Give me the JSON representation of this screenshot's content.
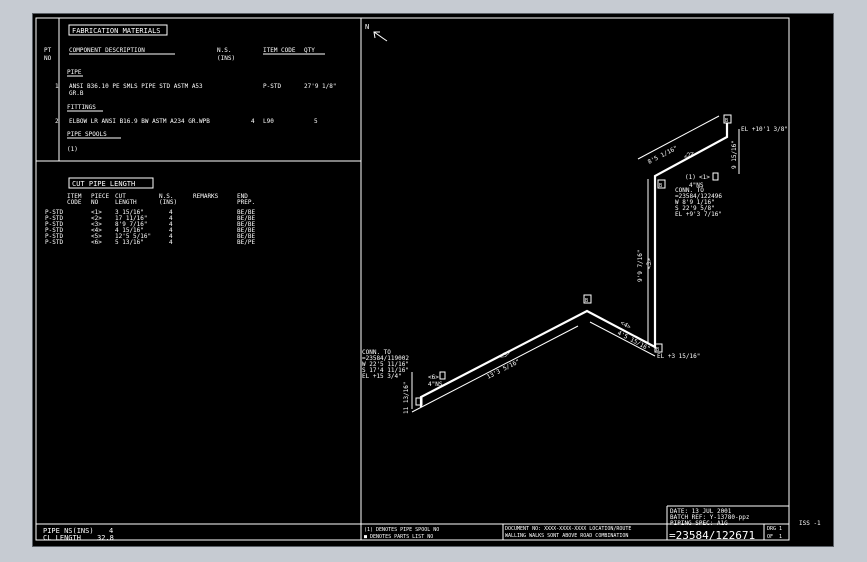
{
  "fabrication_materials": {
    "title": "FABRICATION MATERIALS",
    "col_pt_no": "PT\nNO",
    "col_component": "COMPONENT DESCRIPTION",
    "col_ns": "N.S.\n(INS)",
    "col_item_code": "ITEM CODE",
    "col_qty": "QTY",
    "section_pipe": "PIPE",
    "pipe_item": {
      "pt": "1",
      "desc_line1": "ANSI B36.10 PE SMLS PIPE STD ASTM A53",
      "desc_line2": "GR.B",
      "code": "P-STD",
      "qty": "27'9 1/8\""
    },
    "section_fittings": "FITTINGS",
    "fitting_item": {
      "pt": "2",
      "desc": "ELBOW LR ANSI B16.9 BW ASTM A234 GR.WPB",
      "ns": "4",
      "code": "L90",
      "qty": "5"
    },
    "section_spools": "PIPE SPOOLS",
    "spool_ref": "(1)"
  },
  "cut_pipe_length": {
    "title": "CUT PIPE LENGTH",
    "headers": [
      "ITEM\nCODE",
      "PIECE\nNO",
      "CUT\nLENGTH",
      "N.S.\n(INS)",
      "REMARKS",
      "END\nPREP."
    ],
    "rows": [
      [
        "P-STD",
        "<1>",
        "3 15/16\"",
        "4",
        "",
        "BE/BE"
      ],
      [
        "P-STD",
        "<2>",
        "17 11/16\"",
        "4",
        "",
        "BE/BE"
      ],
      [
        "P-STD",
        "<3>",
        "8'9 7/16\"",
        "4",
        "",
        "BE/BE"
      ],
      [
        "P-STD",
        "<4>",
        "4 15/16\"",
        "4",
        "",
        "BE/BE"
      ],
      [
        "P-STD",
        "<5>",
        "12'5 5/16\"",
        "4",
        "",
        "BE/BE"
      ],
      [
        "P-STD",
        "<6>",
        "5 13/16\"",
        "4",
        "",
        "BE/PE"
      ]
    ]
  },
  "summary": {
    "pipe_ns_label": "PIPE NS(INS)",
    "pipe_ns_value": "4",
    "cl_length_label": "CL LENGTH",
    "cl_length_value": "32.8"
  },
  "isometric": {
    "north": "N",
    "conn_top": [
      "CONN. TO",
      "=23584/122496",
      "W 8'9 1/16\"",
      "S 22'9 5/8\"",
      "EL +9'3 7/16\""
    ],
    "conn_left": [
      "CONN. TO",
      "=23584/119002",
      "W 22'5 11/16\"",
      "S 17'4 11/16\"",
      "EL +15 3/4\""
    ],
    "el_top": "EL +10'1 3/8\"",
    "el_bottom": "EL +3 15/16\"",
    "spool_top": "(1)",
    "spool_top_piece": "<1>",
    "spool_top_ns": "4\"NS",
    "spool_left_piece": "<6>",
    "spool_left_ns": "4\"NS",
    "dim_top_run": "8'5 1/16\"",
    "dim_top_riser": "9 15/16\"",
    "dim_vertical": "9'9 7/16\"",
    "dim_short": "4'5 15/16\"",
    "dim_long": "13'3 5/16\"",
    "dim_left_riser": "11 13/16\"",
    "piece_labels": [
      "<2>",
      "<3>",
      "<4>",
      "<5>"
    ],
    "elbow_marker": "B"
  },
  "notes": {
    "line1": "(1) DENOTES PIPE SPOOL NO",
    "line2": "■ DENOTES PARTS LIST NO"
  },
  "title_block": {
    "date": "DATE: 13 JUL 2001",
    "batch_ref": "BATCH REF: Y-13780-ppz",
    "piping_spec": "PIPING SPEC: A1G",
    "drawing_number": "=23584/122671",
    "drg_label": "DRG",
    "drg_num": "1",
    "of_label": "OF",
    "of_num": "1",
    "iss": "ISS -1",
    "small_text_1": "DOCUMENT NO: XXXX-XXXX-XXXX     LOCATION/ROUTE",
    "small_text_2": "WALLING WALKS SONT ABOVE ROAD COMBINATION"
  }
}
